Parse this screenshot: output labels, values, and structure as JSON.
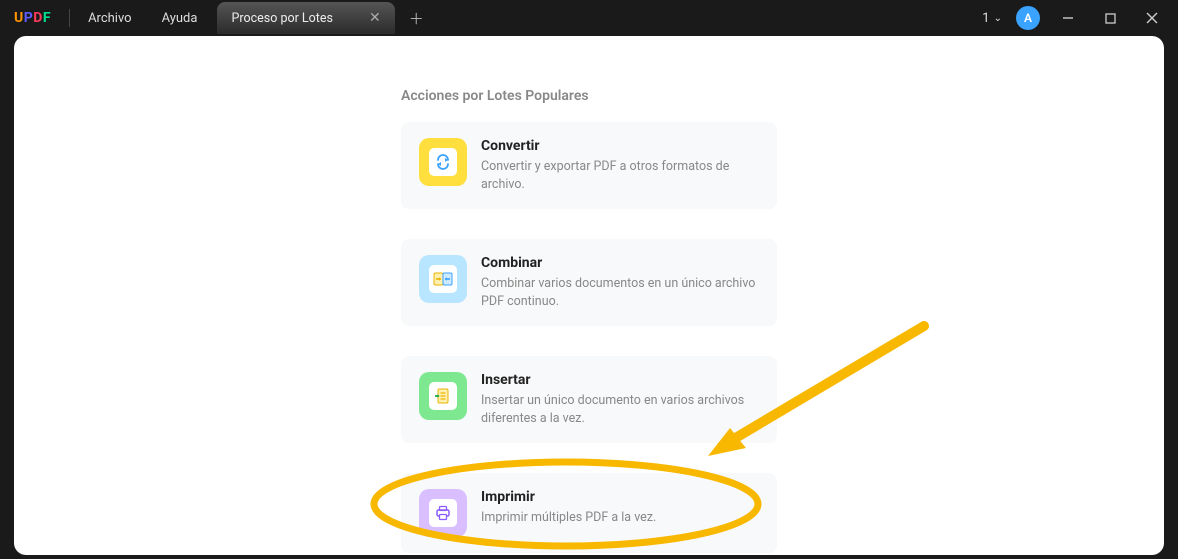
{
  "titlebar": {
    "logo_text": "UPDF",
    "menu": {
      "file": "Archivo",
      "help": "Ayuda"
    },
    "tab_label": "Proceso por Lotes",
    "one_label": "1",
    "avatar_letter": "A"
  },
  "content": {
    "section_title": "Acciones por Lotes Populares",
    "actions": [
      {
        "title": "Convertir",
        "desc": "Convertir y exportar PDF a otros formatos de archivo."
      },
      {
        "title": "Combinar",
        "desc": "Combinar varios documentos en un único archivo PDF continuo."
      },
      {
        "title": "Insertar",
        "desc": "Insertar un único documento en varios archivos diferentes a la vez."
      },
      {
        "title": "Imprimir",
        "desc": "Imprimir múltiples PDF a la vez."
      }
    ]
  }
}
